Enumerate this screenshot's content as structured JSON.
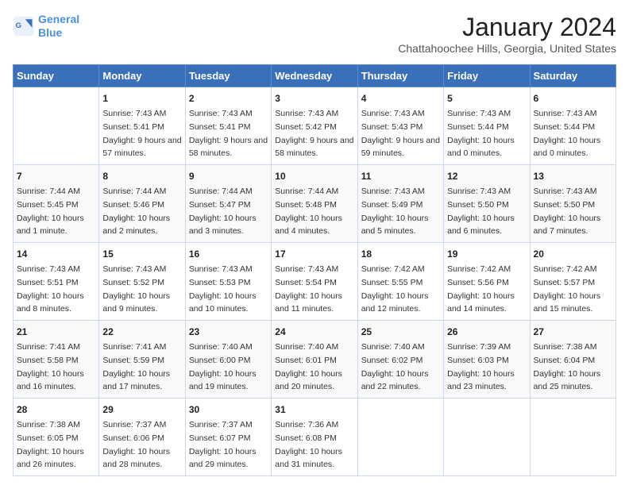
{
  "header": {
    "logo_line1": "General",
    "logo_line2": "Blue",
    "title": "January 2024",
    "subtitle": "Chattahoochee Hills, Georgia, United States"
  },
  "days_of_week": [
    "Sunday",
    "Monday",
    "Tuesday",
    "Wednesday",
    "Thursday",
    "Friday",
    "Saturday"
  ],
  "weeks": [
    [
      {
        "day": "",
        "sunrise": "",
        "sunset": "",
        "daylight": ""
      },
      {
        "day": "1",
        "sunrise": "Sunrise: 7:43 AM",
        "sunset": "Sunset: 5:41 PM",
        "daylight": "Daylight: 9 hours and 57 minutes."
      },
      {
        "day": "2",
        "sunrise": "Sunrise: 7:43 AM",
        "sunset": "Sunset: 5:41 PM",
        "daylight": "Daylight: 9 hours and 58 minutes."
      },
      {
        "day": "3",
        "sunrise": "Sunrise: 7:43 AM",
        "sunset": "Sunset: 5:42 PM",
        "daylight": "Daylight: 9 hours and 58 minutes."
      },
      {
        "day": "4",
        "sunrise": "Sunrise: 7:43 AM",
        "sunset": "Sunset: 5:43 PM",
        "daylight": "Daylight: 9 hours and 59 minutes."
      },
      {
        "day": "5",
        "sunrise": "Sunrise: 7:43 AM",
        "sunset": "Sunset: 5:44 PM",
        "daylight": "Daylight: 10 hours and 0 minutes."
      },
      {
        "day": "6",
        "sunrise": "Sunrise: 7:43 AM",
        "sunset": "Sunset: 5:44 PM",
        "daylight": "Daylight: 10 hours and 0 minutes."
      }
    ],
    [
      {
        "day": "7",
        "sunrise": "Sunrise: 7:44 AM",
        "sunset": "Sunset: 5:45 PM",
        "daylight": "Daylight: 10 hours and 1 minute."
      },
      {
        "day": "8",
        "sunrise": "Sunrise: 7:44 AM",
        "sunset": "Sunset: 5:46 PM",
        "daylight": "Daylight: 10 hours and 2 minutes."
      },
      {
        "day": "9",
        "sunrise": "Sunrise: 7:44 AM",
        "sunset": "Sunset: 5:47 PM",
        "daylight": "Daylight: 10 hours and 3 minutes."
      },
      {
        "day": "10",
        "sunrise": "Sunrise: 7:44 AM",
        "sunset": "Sunset: 5:48 PM",
        "daylight": "Daylight: 10 hours and 4 minutes."
      },
      {
        "day": "11",
        "sunrise": "Sunrise: 7:43 AM",
        "sunset": "Sunset: 5:49 PM",
        "daylight": "Daylight: 10 hours and 5 minutes."
      },
      {
        "day": "12",
        "sunrise": "Sunrise: 7:43 AM",
        "sunset": "Sunset: 5:50 PM",
        "daylight": "Daylight: 10 hours and 6 minutes."
      },
      {
        "day": "13",
        "sunrise": "Sunrise: 7:43 AM",
        "sunset": "Sunset: 5:50 PM",
        "daylight": "Daylight: 10 hours and 7 minutes."
      }
    ],
    [
      {
        "day": "14",
        "sunrise": "Sunrise: 7:43 AM",
        "sunset": "Sunset: 5:51 PM",
        "daylight": "Daylight: 10 hours and 8 minutes."
      },
      {
        "day": "15",
        "sunrise": "Sunrise: 7:43 AM",
        "sunset": "Sunset: 5:52 PM",
        "daylight": "Daylight: 10 hours and 9 minutes."
      },
      {
        "day": "16",
        "sunrise": "Sunrise: 7:43 AM",
        "sunset": "Sunset: 5:53 PM",
        "daylight": "Daylight: 10 hours and 10 minutes."
      },
      {
        "day": "17",
        "sunrise": "Sunrise: 7:43 AM",
        "sunset": "Sunset: 5:54 PM",
        "daylight": "Daylight: 10 hours and 11 minutes."
      },
      {
        "day": "18",
        "sunrise": "Sunrise: 7:42 AM",
        "sunset": "Sunset: 5:55 PM",
        "daylight": "Daylight: 10 hours and 12 minutes."
      },
      {
        "day": "19",
        "sunrise": "Sunrise: 7:42 AM",
        "sunset": "Sunset: 5:56 PM",
        "daylight": "Daylight: 10 hours and 14 minutes."
      },
      {
        "day": "20",
        "sunrise": "Sunrise: 7:42 AM",
        "sunset": "Sunset: 5:57 PM",
        "daylight": "Daylight: 10 hours and 15 minutes."
      }
    ],
    [
      {
        "day": "21",
        "sunrise": "Sunrise: 7:41 AM",
        "sunset": "Sunset: 5:58 PM",
        "daylight": "Daylight: 10 hours and 16 minutes."
      },
      {
        "day": "22",
        "sunrise": "Sunrise: 7:41 AM",
        "sunset": "Sunset: 5:59 PM",
        "daylight": "Daylight: 10 hours and 17 minutes."
      },
      {
        "day": "23",
        "sunrise": "Sunrise: 7:40 AM",
        "sunset": "Sunset: 6:00 PM",
        "daylight": "Daylight: 10 hours and 19 minutes."
      },
      {
        "day": "24",
        "sunrise": "Sunrise: 7:40 AM",
        "sunset": "Sunset: 6:01 PM",
        "daylight": "Daylight: 10 hours and 20 minutes."
      },
      {
        "day": "25",
        "sunrise": "Sunrise: 7:40 AM",
        "sunset": "Sunset: 6:02 PM",
        "daylight": "Daylight: 10 hours and 22 minutes."
      },
      {
        "day": "26",
        "sunrise": "Sunrise: 7:39 AM",
        "sunset": "Sunset: 6:03 PM",
        "daylight": "Daylight: 10 hours and 23 minutes."
      },
      {
        "day": "27",
        "sunrise": "Sunrise: 7:38 AM",
        "sunset": "Sunset: 6:04 PM",
        "daylight": "Daylight: 10 hours and 25 minutes."
      }
    ],
    [
      {
        "day": "28",
        "sunrise": "Sunrise: 7:38 AM",
        "sunset": "Sunset: 6:05 PM",
        "daylight": "Daylight: 10 hours and 26 minutes."
      },
      {
        "day": "29",
        "sunrise": "Sunrise: 7:37 AM",
        "sunset": "Sunset: 6:06 PM",
        "daylight": "Daylight: 10 hours and 28 minutes."
      },
      {
        "day": "30",
        "sunrise": "Sunrise: 7:37 AM",
        "sunset": "Sunset: 6:07 PM",
        "daylight": "Daylight: 10 hours and 29 minutes."
      },
      {
        "day": "31",
        "sunrise": "Sunrise: 7:36 AM",
        "sunset": "Sunset: 6:08 PM",
        "daylight": "Daylight: 10 hours and 31 minutes."
      },
      {
        "day": "",
        "sunrise": "",
        "sunset": "",
        "daylight": ""
      },
      {
        "day": "",
        "sunrise": "",
        "sunset": "",
        "daylight": ""
      },
      {
        "day": "",
        "sunrise": "",
        "sunset": "",
        "daylight": ""
      }
    ]
  ]
}
